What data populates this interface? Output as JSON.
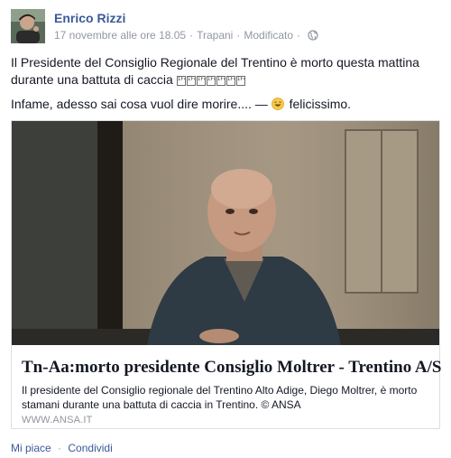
{
  "post": {
    "author": "Enrico Rizzi",
    "date": "17 novembre alle ore 18.05",
    "location": "Trapani",
    "edited": "Modificato",
    "globe_icon": "globe-icon",
    "text_line1": "Il Presidente del Consiglio Regionale del Trentino è morto questa mattina durante una battuta di caccia",
    "emoji_codes": [
      "1F4A5",
      "1F4A5",
      "1F4A5",
      "1F4A5",
      "1F4A5",
      "1F4A5",
      "1F4A5"
    ],
    "text_line2": "Infame, adesso sai cosa vuol dire morire.... —",
    "feeling_icon": "laughing-face-icon",
    "feeling": "felicissimo."
  },
  "share": {
    "title": "Tn-Aa:morto presidente Consiglio Moltrer - Trentino A/S",
    "description": "Il presidente del Consiglio regionale del Trentino Alto Adige, Diego Moltrer, è morto stamani durante una battuta di caccia in Trentino. © ANSA",
    "domain": "WWW.ANSA.IT"
  },
  "actions": {
    "like": "Mi piace",
    "share": "Condividi",
    "separator": "·"
  },
  "colors": {
    "link_blue": "#3b5998",
    "meta_gray": "#9197a3",
    "border": "#dddfe2"
  }
}
